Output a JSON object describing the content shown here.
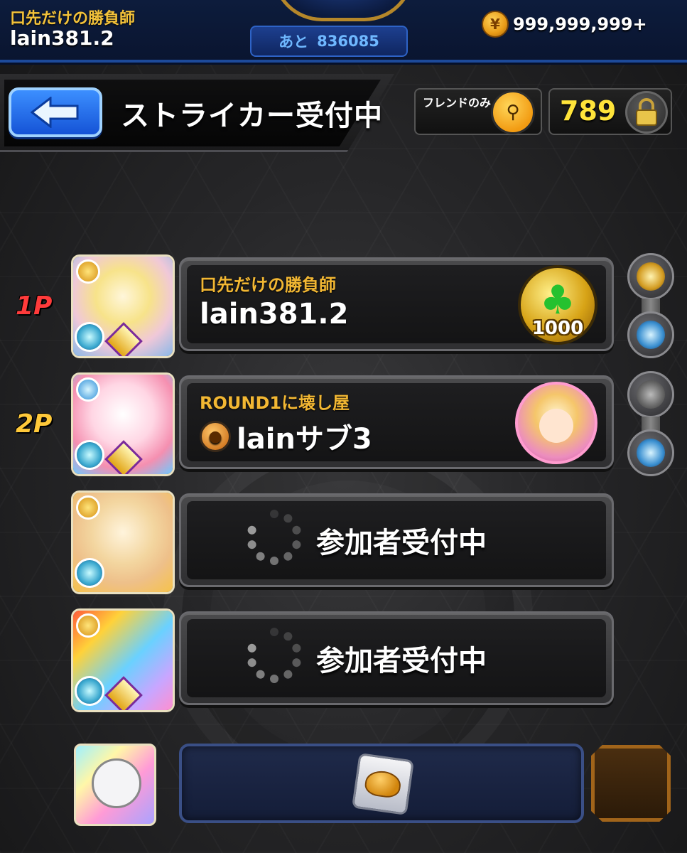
{
  "topbar": {
    "player_title": "口先だけの勝負師",
    "player_id": "lain381.2",
    "countdown_prefix": "あと",
    "countdown_value": "836085",
    "coin_amount": "999,999,999+"
  },
  "header": {
    "title": "ストライカー受付中",
    "friend_filter_label": "フレンドのみ",
    "lock_number": "789"
  },
  "slots": [
    {
      "label": "1P",
      "title": "口先だけの勝負師",
      "name": "lain381.2",
      "luck_value": "1000",
      "state": "joined"
    },
    {
      "label": "2P",
      "title": "ROUND1に壊し屋",
      "name": "lainサブ3",
      "state": "joined"
    },
    {
      "label": "",
      "status": "参加者受付中",
      "state": "waiting"
    },
    {
      "label": "",
      "status": "参加者受付中",
      "state": "waiting"
    }
  ],
  "icons": {
    "back": "back-arrow-icon",
    "coin": "coin-icon",
    "filter": "friend-filter-icon",
    "lock": "lock-icon",
    "luck": "clover-luck-icon",
    "group": "group-icon",
    "item": "item-icon"
  },
  "colors": {
    "accent_gold": "#f2b733",
    "player1": "#ff3b3b",
    "player2": "#ffc93a",
    "topbar": "#0d1c3c",
    "back_button": "#1553d6"
  }
}
